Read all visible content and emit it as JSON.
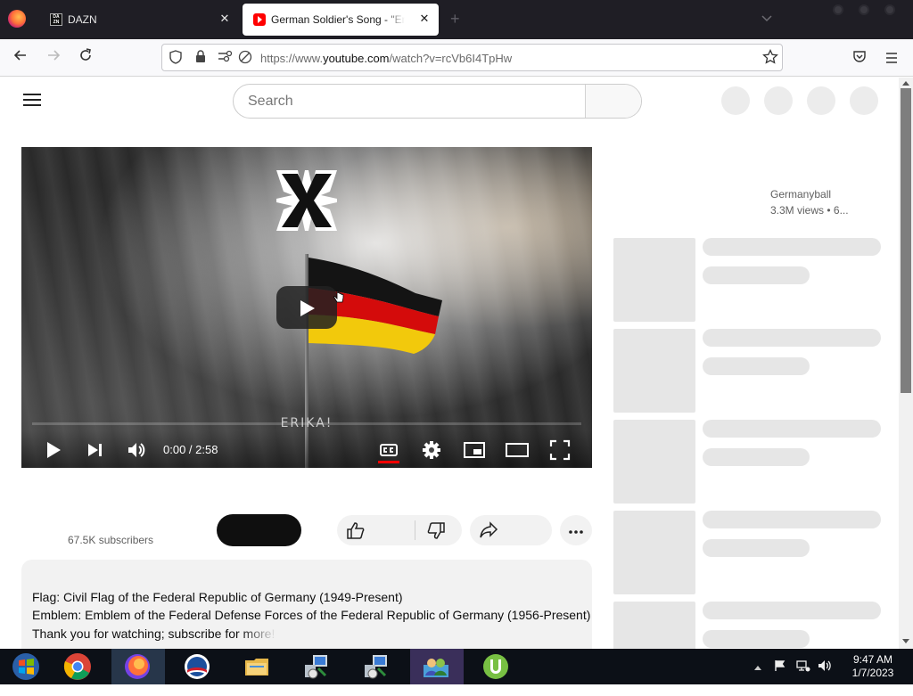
{
  "browser": {
    "tabs": [
      {
        "label": "DAZN",
        "icon": "dazn-icon",
        "favicon_text": "DA ZN"
      },
      {
        "label": "German Soldier's Song - \"Erika\"",
        "icon": "youtube-icon",
        "active": true
      }
    ],
    "new_tab_label": "+",
    "close_label": "✕",
    "url_prefix": "https://www.",
    "url_domain": "youtube.com",
    "url_path": "/watch?v=rcVb6I4TpHw"
  },
  "youtube": {
    "search_placeholder": "Search",
    "video": {
      "overlay_text": "ERIKA!",
      "time": "0:00 / 2:58",
      "progress": 0
    },
    "subscribers": "67.5K subscribers",
    "description": [
      "Flag: Civil Flag of the Federal Republic of Germany (1949-Present)",
      "Emblem: Emblem of the Federal Defense Forces of the Federal Republic of Germany (1956-Present)",
      "Thank you for watching; subscribe for more!"
    ],
    "sidebar": {
      "channel": "Germanyball",
      "views": "3.3M views",
      "views_suffix": "• 6..."
    },
    "skeleton_count": 5
  },
  "colors": {
    "youtube_red": "#ff0000",
    "subscribe_button": "#0f0f0f",
    "skeleton": "#e6e6e6",
    "taskbar": "#0c1017"
  },
  "taskbar": {
    "items": [
      {
        "name": "start-icon"
      },
      {
        "name": "chrome-icon"
      },
      {
        "name": "firefox-icon",
        "active": true
      },
      {
        "name": "obama-logo-icon"
      },
      {
        "name": "file-explorer-icon"
      },
      {
        "name": "network-setup-icon"
      },
      {
        "name": "network-setup-2-icon"
      },
      {
        "name": "users-icon"
      },
      {
        "name": "utorrent-icon"
      }
    ],
    "tray_chevron": "▲",
    "time": "9:47 AM",
    "date": "1/7/2023"
  }
}
